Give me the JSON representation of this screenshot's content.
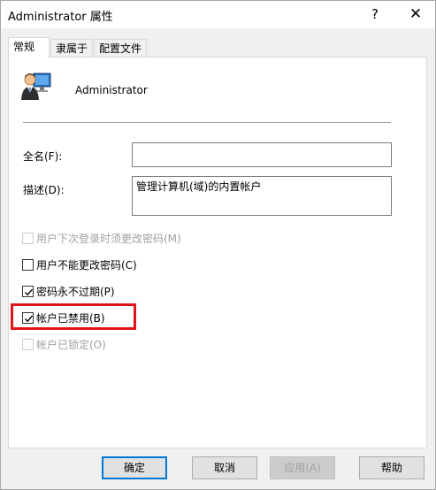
{
  "window": {
    "title": "Administrator 属性",
    "help_glyph": "?",
    "close_glyph": "✕"
  },
  "tabs": [
    {
      "label": "常规",
      "active": true
    },
    {
      "label": "隶属于",
      "active": false
    },
    {
      "label": "配置文件",
      "active": false
    }
  ],
  "general": {
    "user_icon": "user-monitor-icon",
    "user_name": "Administrator",
    "fullname_label": "全名(F):",
    "fullname_value": "",
    "description_label": "描述(D):",
    "description_value": "管理计算机(域)的内置帐户",
    "options": [
      {
        "label": "用户下次登录时须更改密码(M)",
        "checked": false,
        "enabled": false
      },
      {
        "label": "用户不能更改密码(C)",
        "checked": false,
        "enabled": true
      },
      {
        "label": "密码永不过期(P)",
        "checked": true,
        "enabled": true
      },
      {
        "label": "帐户已禁用(B)",
        "checked": true,
        "enabled": true
      },
      {
        "label": "帐户已锁定(O)",
        "checked": false,
        "enabled": false
      }
    ],
    "highlight_color": "#e0151a"
  },
  "buttons": {
    "ok": "确定",
    "cancel": "取消",
    "apply": "应用(A)",
    "help": "帮助"
  },
  "colors": {
    "accent": "#0078d7"
  }
}
